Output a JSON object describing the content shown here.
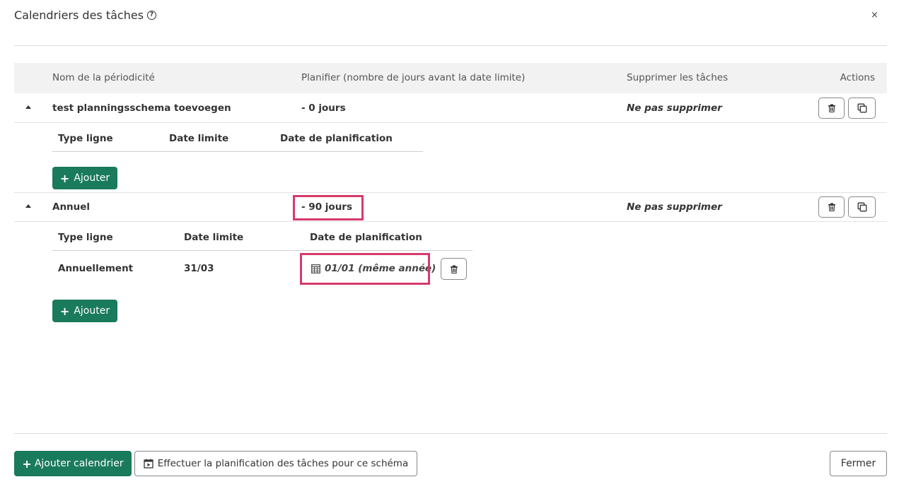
{
  "dialog": {
    "title": "Calendriers des tâches",
    "help_icon": "?",
    "close_icon": "×"
  },
  "table": {
    "headers": {
      "name": "Nom de la périodicité",
      "plan": "Planifier (nombre de jours avant la date limite)",
      "delete": "Supprimer les tâches",
      "actions": "Actions"
    },
    "rows": [
      {
        "name": "test planningsschema toevoegen",
        "plan": "- 0 jours",
        "delete": "Ne pas supprimer",
        "sub_headers": {
          "type": "Type ligne",
          "date": "Date limite",
          "planning": "Date de planification"
        },
        "add_label": "Ajouter"
      },
      {
        "name": "Annuel",
        "plan": "- 90 jours",
        "delete": "Ne pas supprimer",
        "sub_headers": {
          "type": "Type ligne",
          "date": "Date limite",
          "planning": "Date de planification"
        },
        "sub_rows": [
          {
            "type": "Annuellement",
            "date": "31/03",
            "planning": "01/01 (même année)"
          }
        ],
        "add_label": "Ajouter"
      }
    ]
  },
  "footer": {
    "add_calendar": "Ajouter calendrier",
    "run_planning": "Effectuer la planification des tâches pour ce schéma",
    "close": "Fermer"
  },
  "colors": {
    "primary": "#1a7a5c",
    "highlight": "#d63a6b"
  }
}
